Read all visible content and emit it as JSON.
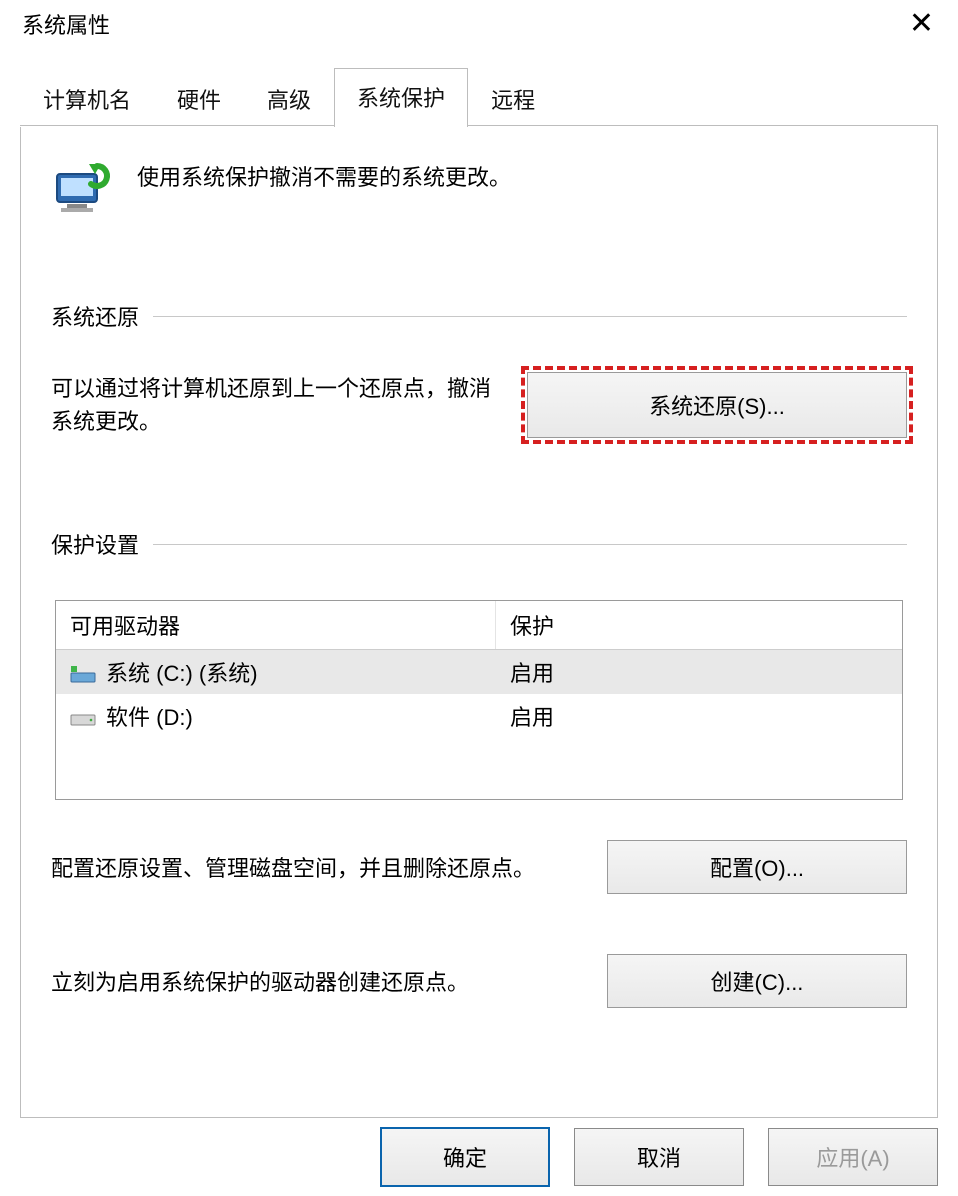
{
  "window": {
    "title": "系统属性"
  },
  "tabs": [
    {
      "label": "计算机名"
    },
    {
      "label": "硬件"
    },
    {
      "label": "高级"
    },
    {
      "label": "系统保护",
      "active": true
    },
    {
      "label": "远程"
    }
  ],
  "hero_text": "使用系统保护撤消不需要的系统更改。",
  "section_restore": {
    "title": "系统还原",
    "desc": "可以通过将计算机还原到上一个还原点，撤消系统更改。",
    "button": "系统还原(S)..."
  },
  "section_protect": {
    "title": "保护设置",
    "columns": {
      "drive": "可用驱动器",
      "protection": "保护"
    },
    "rows": [
      {
        "name": "系统 (C:) (系统)",
        "protection": "启用",
        "icon": "system-drive",
        "selected": true
      },
      {
        "name": "软件 (D:)",
        "protection": "启用",
        "icon": "drive",
        "selected": false
      }
    ],
    "configure_desc": "配置还原设置、管理磁盘空间，并且删除还原点。",
    "configure_button": "配置(O)...",
    "create_desc": "立刻为启用系统保护的驱动器创建还原点。",
    "create_button": "创建(C)..."
  },
  "footer": {
    "ok": "确定",
    "cancel": "取消",
    "apply": "应用(A)"
  }
}
